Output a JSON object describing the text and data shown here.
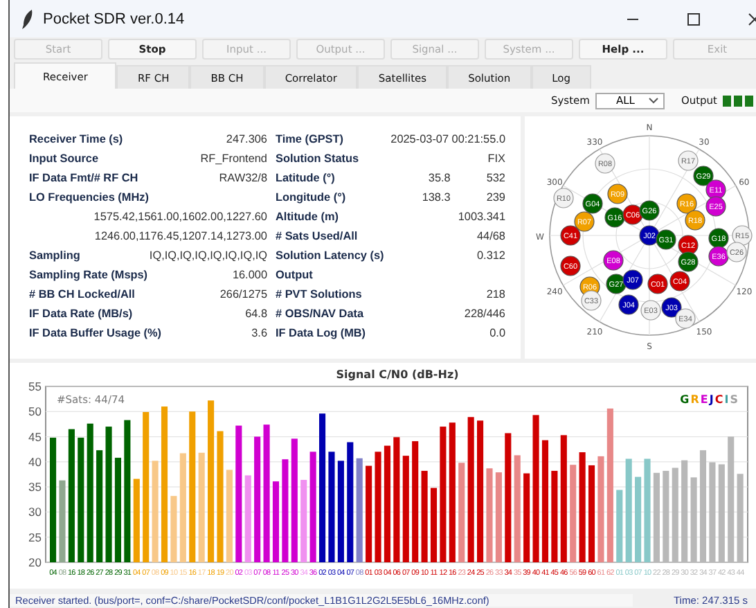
{
  "window": {
    "title": "Pocket SDR ver.0.14"
  },
  "toolbar": [
    {
      "label": "Start",
      "disabled": true
    },
    {
      "label": "Stop",
      "disabled": false
    },
    {
      "label": "Input ...",
      "disabled": true
    },
    {
      "label": "Output ...",
      "disabled": true
    },
    {
      "label": "Signal ...",
      "disabled": true
    },
    {
      "label": "System ...",
      "disabled": true
    },
    {
      "label": "Help ...",
      "disabled": false
    },
    {
      "label": "Exit",
      "disabled": true
    }
  ],
  "tabs": [
    {
      "label": "Receiver",
      "selected": true
    },
    {
      "label": "RF CH",
      "selected": false
    },
    {
      "label": "BB CH",
      "selected": false
    },
    {
      "label": "Correlator",
      "selected": false
    },
    {
      "label": "Satellites",
      "selected": false
    },
    {
      "label": "Solution",
      "selected": false
    },
    {
      "label": "Log",
      "selected": false
    }
  ],
  "system_filter": {
    "label": "System",
    "value": "ALL"
  },
  "output": {
    "label": "Output"
  },
  "info_rows": [
    {
      "left_label": "Receiver Time (s)",
      "left_value": "247.306",
      "right_label": "Time (GPST)",
      "right_values": [
        "2025-03-07 00:21:55.0"
      ]
    },
    {
      "left_label": "Input Source",
      "left_value": "RF_Frontend",
      "right_label": "Solution Status",
      "right_values": [
        "FIX"
      ]
    },
    {
      "left_label": "IF Data Fmt/# RF CH",
      "left_value": "RAW32/8",
      "right_label": "Latitude (°)",
      "right_values": [
        "35.8",
        "532"
      ]
    },
    {
      "left_label": "LO Frequencies (MHz)",
      "right_label": "Longitude (°)",
      "right_values": [
        "138.3",
        "239"
      ]
    },
    {
      "left_value": "1575.42,1561.00,1602.00,1227.60",
      "right_label": "Altitude (m)",
      "right_values": [
        "1003.341"
      ]
    },
    {
      "left_value": "1246.00,1176.45,1207.14,1273.00",
      "right_label": "# Sats Used/All",
      "right_values": [
        "44/68"
      ]
    },
    {
      "left_label": "Sampling",
      "left_value": "IQ,IQ,IQ,IQ,IQ,IQ,IQ,IQ",
      "right_label": "Solution Latency (s)",
      "right_values": [
        "0.312"
      ]
    },
    {
      "left_label": "Sampling Rate (Msps)",
      "left_value": "16.000",
      "right_label": "Output"
    },
    {
      "left_label": "# BB CH Locked/All",
      "left_value": "266/1275",
      "right_label": "# PVT Solutions",
      "right_values": [
        "218"
      ]
    },
    {
      "left_label": "IF Data Rate (MB/s)",
      "left_value": "64.8",
      "right_label": "# OBS/NAV Data",
      "right_values": [
        "228/446"
      ]
    },
    {
      "left_label": "IF Data Buffer Usage (%)",
      "left_value": "3.6",
      "right_label": "IF Data Log (MB)",
      "right_values": [
        "0.0"
      ]
    }
  ],
  "skyplot": {
    "directions": [
      "N",
      "30",
      "60",
      "120",
      "150",
      "S",
      "210",
      "240",
      "W",
      "300",
      "330"
    ],
    "satellites": [
      {
        "id": "R08",
        "kind": "outline",
        "color": "#f2f2f2"
      },
      {
        "id": "R17",
        "kind": "outline",
        "color": "#f2f2f2"
      },
      {
        "id": "G29",
        "kind": "filled",
        "color": "#006400"
      },
      {
        "id": "R09",
        "kind": "filled",
        "color": "#f0a000"
      },
      {
        "id": "E11",
        "kind": "filled",
        "color": "#d000d0"
      },
      {
        "id": "R10",
        "kind": "outline",
        "color": "#f2f2f2"
      },
      {
        "id": "G04",
        "kind": "filled",
        "color": "#006400"
      },
      {
        "id": "R16",
        "kind": "filled",
        "color": "#f0a000"
      },
      {
        "id": "E25",
        "kind": "filled",
        "color": "#d000d0"
      },
      {
        "id": "R07",
        "kind": "filled",
        "color": "#f0a000"
      },
      {
        "id": "G16",
        "kind": "filled",
        "color": "#006400"
      },
      {
        "id": "C06",
        "kind": "filled",
        "color": "#d00000"
      },
      {
        "id": "G26",
        "kind": "filled",
        "color": "#006400"
      },
      {
        "id": "R18",
        "kind": "filled",
        "color": "#f0a000"
      },
      {
        "id": "C41",
        "kind": "filled",
        "color": "#d00000"
      },
      {
        "id": "J02",
        "kind": "filled",
        "color": "#0000b0"
      },
      {
        "id": "G31",
        "kind": "filled",
        "color": "#006400"
      },
      {
        "id": "G18",
        "kind": "filled",
        "color": "#006400"
      },
      {
        "id": "R15",
        "kind": "outline",
        "color": "#f2f2f2"
      },
      {
        "id": "C60",
        "kind": "filled",
        "color": "#d00000"
      },
      {
        "id": "E08",
        "kind": "filled",
        "color": "#d000d0"
      },
      {
        "id": "C12",
        "kind": "filled",
        "color": "#d00000"
      },
      {
        "id": "G28",
        "kind": "filled",
        "color": "#006400"
      },
      {
        "id": "E36",
        "kind": "filled",
        "color": "#d000d0"
      },
      {
        "id": "C26",
        "kind": "outline",
        "color": "#f2f2f2"
      },
      {
        "id": "R06",
        "kind": "filled",
        "color": "#f0a000"
      },
      {
        "id": "G27",
        "kind": "filled",
        "color": "#006400"
      },
      {
        "id": "J07",
        "kind": "filled",
        "color": "#0000b0"
      },
      {
        "id": "C01",
        "kind": "filled",
        "color": "#d00000"
      },
      {
        "id": "C04",
        "kind": "filled",
        "color": "#d00000"
      },
      {
        "id": "C33",
        "kind": "outline",
        "color": "#f2f2f2"
      },
      {
        "id": "J04",
        "kind": "filled",
        "color": "#0000b0"
      },
      {
        "id": "E03",
        "kind": "outline",
        "color": "#f2f2f2"
      },
      {
        "id": "J03",
        "kind": "filled",
        "color": "#0000b0"
      },
      {
        "id": "E34",
        "kind": "outline",
        "color": "#f2f2f2"
      }
    ]
  },
  "signal_chart": {
    "sats_label": "#Sats: 44/74",
    "legend": [
      {
        "letter": "G",
        "color": "#006400"
      },
      {
        "letter": "R",
        "color": "#f0a000"
      },
      {
        "letter": "E",
        "color": "#d000d0"
      },
      {
        "letter": "J",
        "color": "#0000b0"
      },
      {
        "letter": "C",
        "color": "#d00000"
      },
      {
        "letter": "I",
        "color": "#40a0a0"
      },
      {
        "letter": "S",
        "color": "#a0a0a0"
      }
    ],
    "chart_data": {
      "type": "bar",
      "title": "Signal C/N0 (dB-Hz)",
      "ylim": [
        20,
        55
      ],
      "yticks": [
        20,
        25,
        30,
        35,
        40,
        45,
        50,
        55
      ],
      "grid": true,
      "categories": [
        "04",
        "08",
        "16",
        "18",
        "26",
        "27",
        "28",
        "29",
        "31",
        "04",
        "07",
        "08",
        "09",
        "10",
        "15",
        "16",
        "17",
        "18",
        "19",
        "20",
        "02",
        "03",
        "07",
        "08",
        "11",
        "25",
        "30",
        "34",
        "36",
        "02",
        "03",
        "04",
        "07",
        "08",
        "01",
        "03",
        "04",
        "06",
        "07",
        "09",
        "10",
        "11",
        "12",
        "16",
        "23",
        "24",
        "25",
        "26",
        "33",
        "34",
        "35",
        "39",
        "40",
        "41",
        "45",
        "46",
        "56",
        "59",
        "60",
        "61",
        "62",
        "01",
        "03",
        "07",
        "10",
        "22",
        "28",
        "29",
        "30",
        "32",
        "34",
        "37",
        "42",
        "43",
        "44"
      ],
      "series": [
        {
          "values": [
            44.8,
            36.3,
            46.5,
            44.8,
            47.6,
            42.3,
            47.0,
            40.8,
            48.3,
            36.6,
            49.9,
            40.2,
            51.0,
            33.2,
            41.7,
            50.0,
            41.8,
            52.2,
            46.1,
            38.4,
            47.2,
            37.3,
            45.0,
            47.4,
            36.1,
            40.5,
            44.6,
            36.4,
            42.0,
            49.6,
            42.0,
            40.2,
            43.9,
            40.7,
            39.2,
            42.0,
            43.2,
            44.9,
            41.2,
            44.1,
            38.2,
            34.8,
            47.0,
            47.8,
            39.8,
            48.9,
            48.2,
            38.7,
            37.9,
            45.7,
            41.3,
            37.7,
            49.3,
            44.3,
            38.2,
            45.3,
            39.4,
            41.9,
            39.3,
            41.1,
            50.6,
            34.4,
            40.6,
            37.0,
            40.6,
            37.8,
            38.2,
            38.8,
            40.3,
            36.9,
            42.3,
            39.9,
            39.5,
            45.0,
            37.6
          ]
        }
      ]
    },
    "bars": [
      {
        "color": "#006400"
      },
      {
        "color": "#8fa88f"
      },
      {
        "color": "#006400"
      },
      {
        "color": "#006400"
      },
      {
        "color": "#006400"
      },
      {
        "color": "#006400"
      },
      {
        "color": "#006400"
      },
      {
        "color": "#006400"
      },
      {
        "color": "#006400"
      },
      {
        "color": "#f0a000"
      },
      {
        "color": "#f0a000"
      },
      {
        "color": "#f8c888"
      },
      {
        "color": "#f0a000"
      },
      {
        "color": "#f8c888"
      },
      {
        "color": "#f8c888"
      },
      {
        "color": "#f0a000"
      },
      {
        "color": "#f8c888"
      },
      {
        "color": "#f0a000"
      },
      {
        "color": "#f0a000"
      },
      {
        "color": "#f8c888"
      },
      {
        "color": "#d000d0"
      },
      {
        "color": "#f090f0"
      },
      {
        "color": "#d000d0"
      },
      {
        "color": "#d000d0"
      },
      {
        "color": "#d000d0"
      },
      {
        "color": "#d000d0"
      },
      {
        "color": "#d000d0"
      },
      {
        "color": "#f090f0"
      },
      {
        "color": "#d000d0"
      },
      {
        "color": "#0000b0"
      },
      {
        "color": "#0000b0"
      },
      {
        "color": "#0000b0"
      },
      {
        "color": "#0000b0"
      },
      {
        "color": "#8080c8"
      },
      {
        "color": "#d00000"
      },
      {
        "color": "#d00000"
      },
      {
        "color": "#d00000"
      },
      {
        "color": "#d00000"
      },
      {
        "color": "#d00000"
      },
      {
        "color": "#d00000"
      },
      {
        "color": "#d00000"
      },
      {
        "color": "#d00000"
      },
      {
        "color": "#d00000"
      },
      {
        "color": "#d00000"
      },
      {
        "color": "#e88888"
      },
      {
        "color": "#d00000"
      },
      {
        "color": "#d00000"
      },
      {
        "color": "#e88888"
      },
      {
        "color": "#e88888"
      },
      {
        "color": "#d00000"
      },
      {
        "color": "#e88888"
      },
      {
        "color": "#d00000"
      },
      {
        "color": "#d00000"
      },
      {
        "color": "#d00000"
      },
      {
        "color": "#d00000"
      },
      {
        "color": "#d00000"
      },
      {
        "color": "#e88888"
      },
      {
        "color": "#d00000"
      },
      {
        "color": "#d00000"
      },
      {
        "color": "#e88888"
      },
      {
        "color": "#e88888"
      },
      {
        "color": "#88c8c8"
      },
      {
        "color": "#88c8c8"
      },
      {
        "color": "#88c8c8"
      },
      {
        "color": "#88c8c8"
      },
      {
        "color": "#b8b8b8"
      },
      {
        "color": "#b8b8b8"
      },
      {
        "color": "#b8b8b8"
      },
      {
        "color": "#b8b8b8"
      },
      {
        "color": "#b8b8b8"
      },
      {
        "color": "#b8b8b8"
      },
      {
        "color": "#b8b8b8"
      },
      {
        "color": "#b8b8b8"
      },
      {
        "color": "#b8b8b8"
      },
      {
        "color": "#b8b8b8"
      }
    ]
  },
  "status_bar": {
    "message": "Receiver started. (bus/port=, conf=C:/share/PocketSDR/conf/pocket_L1B1G1L2G2L5E5bL6_16MHz.conf)",
    "time": "Time: 247.315 s"
  }
}
